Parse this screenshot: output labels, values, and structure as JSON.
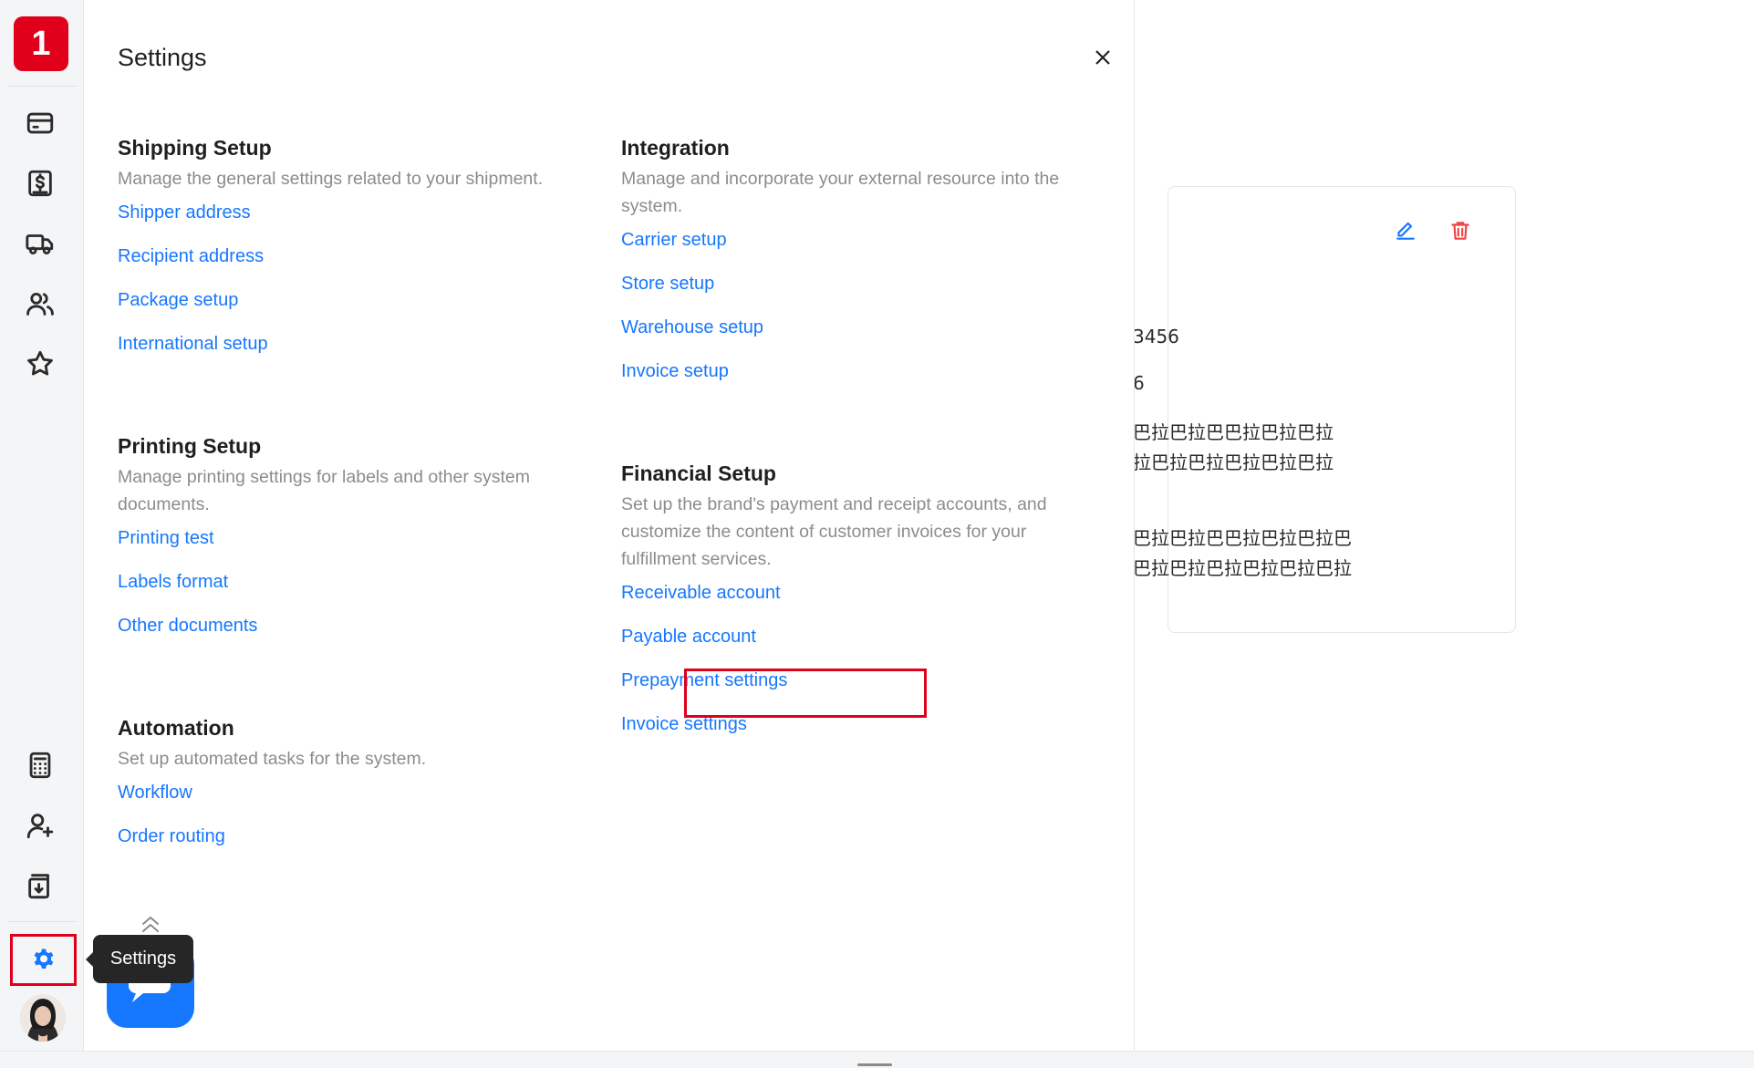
{
  "app": {
    "logo_text": "1",
    "brand_color": "#e1001b",
    "link_color": "#1677ff"
  },
  "rail": {
    "top_icons": [
      "wallet-icon",
      "billing-icon",
      "truck-icon",
      "users-icon",
      "star-icon"
    ],
    "bottom_icons": [
      "calculator-icon",
      "add-user-icon",
      "download-doc-icon"
    ],
    "active_icon": "gear-icon"
  },
  "tooltip": {
    "text": "Settings"
  },
  "drawer": {
    "title": "Settings",
    "sections": {
      "shipping": {
        "title": "Shipping Setup",
        "desc": "Manage the general settings related to your shipment.",
        "links": [
          "Shipper address",
          "Recipient address",
          "Package setup",
          "International setup"
        ]
      },
      "printing": {
        "title": "Printing Setup",
        "desc": "Manage printing settings for labels and other system documents.",
        "links": [
          "Printing test",
          "Labels format",
          "Other documents"
        ]
      },
      "automation": {
        "title": "Automation",
        "desc": "Set up automated tasks for the system.",
        "links": [
          "Workflow",
          "Order routing"
        ]
      },
      "integration": {
        "title": "Integration",
        "desc": "Manage and incorporate your external resource into the system.",
        "links": [
          "Carrier setup",
          "Store setup",
          "Warehouse setup",
          "Invoice setup"
        ]
      },
      "financial": {
        "title": "Financial Setup",
        "desc": "Set up the brand's payment and receipt accounts, and customize the content of customer invoices for your fulfillment services.",
        "links": [
          "Receivable account",
          "Payable account",
          "Prepayment settings",
          "Invoice settings"
        ]
      }
    }
  },
  "background_card": {
    "line1": "3456",
    "line2": "6",
    "line3a": "巴拉巴拉巴巴拉巴拉巴拉",
    "line3b": "拉巴拉巴拉巴拉巴拉巴拉",
    "line4a": "巴拉巴拉巴巴拉巴拉巴拉巴",
    "line4b": "巴拉巴拉巴拉巴拉巴拉巴拉"
  }
}
